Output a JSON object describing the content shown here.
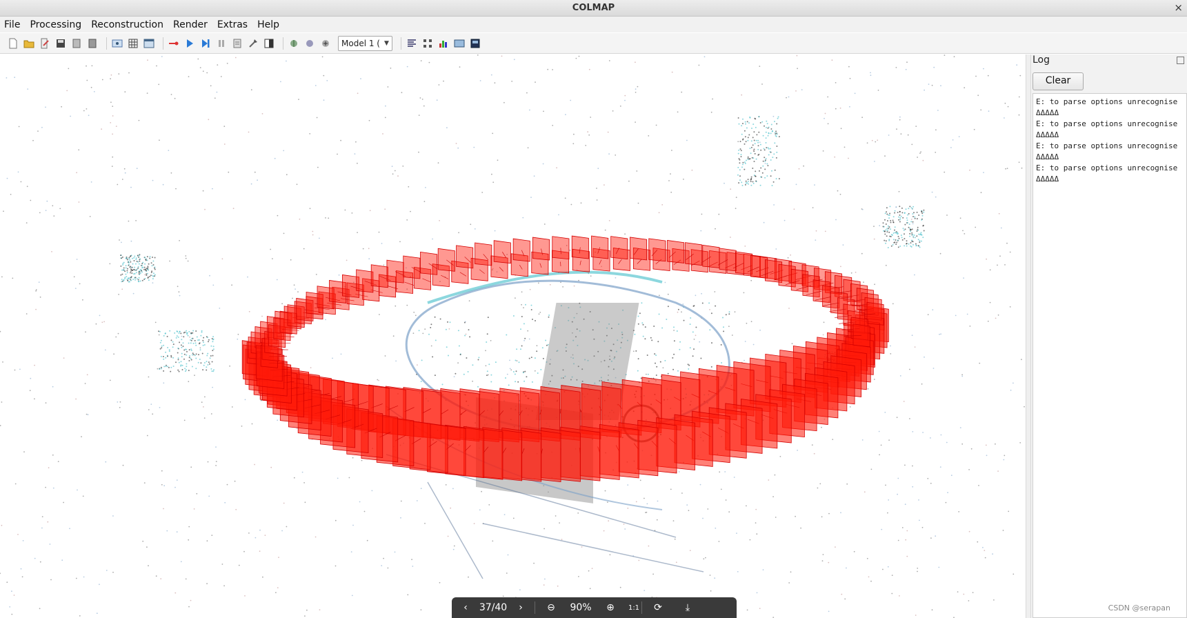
{
  "window": {
    "title": "COLMAP",
    "close_glyph": "×"
  },
  "menu": {
    "items": [
      "File",
      "Processing",
      "Reconstruction",
      "Render",
      "Extras",
      "Help"
    ]
  },
  "toolbar": {
    "model_select": {
      "value": "Model 1 ("
    },
    "icons": [
      "new-project-icon",
      "open-project-icon",
      "edit-project-icon",
      "save-project-icon",
      "import-model-icon",
      "export-model-icon",
      "feature-extraction-icon",
      "feature-matching-icon",
      "database-management-icon",
      "auto-reconstruction-icon",
      "start-reconstruction-icon",
      "step-reconstruction-icon",
      "pause-reconstruction-icon",
      "reconstruction-options-icon",
      "bundle-adjustment-icon",
      "dense-reconstruction-icon",
      "render-options-icon",
      "reset-view-icon",
      "zoom-in-icon",
      "zoom-out-icon",
      "show-model-stats-icon",
      "show-match-matrix-icon",
      "show-log-icon",
      "undistort-icon",
      "grab-image-icon"
    ]
  },
  "log": {
    "title": "Log",
    "clear_label": "Clear",
    "lines": [
      "E:  to parse options unrecognise",
      "ΔΔΔΔΔ",
      "E:  to parse options unrecognise",
      "ΔΔΔΔΔ",
      "E:  to parse options unrecognise",
      "ΔΔΔΔΔ",
      "E:  to parse options unrecognise",
      "ΔΔΔΔΔ"
    ]
  },
  "viewer_bar": {
    "page": "37/40",
    "zoom": "90%",
    "actual_size": "1:1"
  },
  "watermark": "CSDN @serapan",
  "colors": {
    "camera": "#ff1a0a",
    "points_dark": "#2a2a2a",
    "points_blue": "#7aa0c8",
    "points_cyan": "#3fbcc8"
  }
}
